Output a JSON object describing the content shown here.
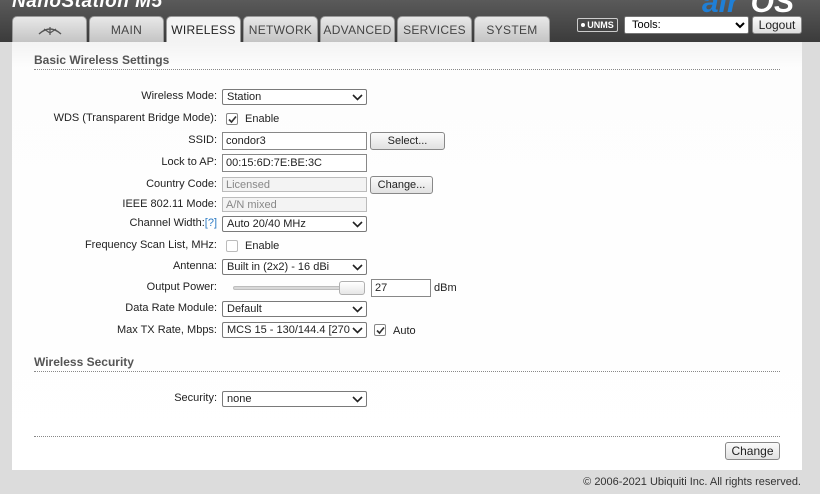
{
  "header": {
    "brand": "NanoStation M5",
    "logo_air": "air",
    "logo_ac": "OS",
    "unms_label": "UNMS",
    "tools_label": "Tools:",
    "logout_label": "Logout"
  },
  "tabs": [
    {
      "label": "",
      "icon": "ubiquiti-logo-icon"
    },
    {
      "label": "MAIN"
    },
    {
      "label": "WIRELESS",
      "active": true
    },
    {
      "label": "NETWORK"
    },
    {
      "label": "ADVANCED"
    },
    {
      "label": "SERVICES"
    },
    {
      "label": "SYSTEM"
    }
  ],
  "basic": {
    "title": "Basic Wireless Settings",
    "wireless_mode": {
      "label": "Wireless Mode:",
      "value": "Station"
    },
    "wds": {
      "label": "WDS (Transparent Bridge Mode):",
      "checked": true,
      "option": "Enable"
    },
    "ssid": {
      "label": "SSID:",
      "value": "condor3",
      "button": "Select..."
    },
    "lock_ap": {
      "label": "Lock to AP:",
      "value": "00:15:6D:7E:BE:3C"
    },
    "country": {
      "label": "Country Code:",
      "value": "Licensed",
      "button": "Change..."
    },
    "ieee_mode": {
      "label": "IEEE 802.11 Mode:",
      "value": "A/N mixed"
    },
    "channel_width": {
      "label": "Channel Width:",
      "help": "[?]",
      "value": "Auto 20/40 MHz"
    },
    "freq_scan": {
      "label": "Frequency Scan List, MHz:",
      "checked": false,
      "option": "Enable"
    },
    "antenna": {
      "label": "Antenna:",
      "value": "Built in (2x2) - 16 dBi"
    },
    "output_power": {
      "label": "Output Power:",
      "value": "27",
      "unit": "dBm"
    },
    "data_rate_module": {
      "label": "Data Rate Module:",
      "value": "Default"
    },
    "max_tx_rate": {
      "label": "Max TX Rate, Mbps:",
      "value": "MCS 15 - 130/144.4 [270",
      "auto_checked": true,
      "auto_label": "Auto"
    }
  },
  "security": {
    "title": "Wireless Security",
    "label": "Security:",
    "value": "none"
  },
  "footer": {
    "change_label": "Change",
    "copyright": "© 2006-2021 Ubiquiti Inc. All rights reserved."
  }
}
